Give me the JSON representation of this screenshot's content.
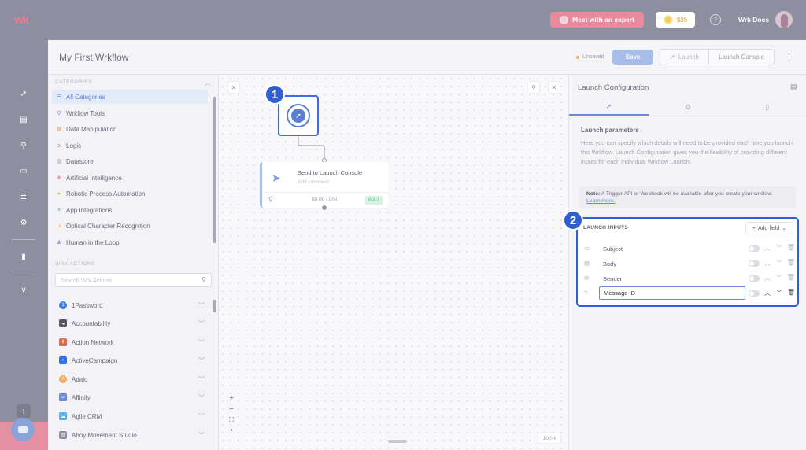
{
  "app": {
    "logo": "wk"
  },
  "topbar": {
    "meet_label": "Meet with an expert",
    "credits": "$35",
    "help_icon": "question-icon",
    "user_name": "Wrk Docs"
  },
  "rail": {
    "icons": [
      "rocket-icon",
      "id-card-icon",
      "wrench-icon",
      "folder-icon",
      "database-icon",
      "gear-icon",
      "book-icon",
      "cart-icon"
    ]
  },
  "header": {
    "title": "My First Wrkflow",
    "status": "Unsaved",
    "save_label": "Save",
    "launch_label": "Launch",
    "console_label": "Launch Console"
  },
  "categories": {
    "title": "CATEGORIES",
    "items": [
      {
        "label": "All Categories",
        "icon": "list-icon",
        "color": "#5b7fd1"
      },
      {
        "label": "Wrkflow Tools",
        "icon": "wrench-icon",
        "color": "#7a99de"
      },
      {
        "label": "Data Manipulation",
        "icon": "grid-icon",
        "color": "#e8a878"
      },
      {
        "label": "Logic",
        "icon": "greater-equal-icon",
        "color": "#e26a7a"
      },
      {
        "label": "Datastore",
        "icon": "database-icon",
        "color": "#8f8fa0"
      },
      {
        "label": "Artificial Intelligence",
        "icon": "brain-icon",
        "color": "#e88a9c"
      },
      {
        "label": "Robotic Process Automation",
        "icon": "robot-icon",
        "color": "#b7d35b"
      },
      {
        "label": "App Integrations",
        "icon": "plug-icon",
        "color": "#6cc7a0"
      },
      {
        "label": "Optical Character Recognition",
        "icon": "ocr-icon",
        "color": "#e8b24d"
      },
      {
        "label": "Human in the Loop",
        "icon": "person-icon",
        "color": "#b39ad8"
      }
    ]
  },
  "actions": {
    "title": "WRK ACTIONS",
    "search_placeholder": "Search Wrk Actions",
    "items": [
      {
        "label": "1Password",
        "color": "#3a7ee6"
      },
      {
        "label": "Accountability",
        "color": "#555566"
      },
      {
        "label": "Action Network",
        "color": "#e26a4a"
      },
      {
        "label": "ActiveCampaign",
        "color": "#3a6fe8"
      },
      {
        "label": "Adalo",
        "color": "#f0a860"
      },
      {
        "label": "Affinity",
        "color": "#6a8ad8"
      },
      {
        "label": "Agile CRM",
        "color": "#58b4e8"
      },
      {
        "label": "Ahoy Movement Studio",
        "color": "#8f8fa0"
      }
    ]
  },
  "canvas": {
    "step1": "1",
    "node_title": "Send to Launch Console",
    "node_sub": "Add comment",
    "node_cost": "$0.00 / unit",
    "node_badge": "WA-1",
    "zoom": "100%"
  },
  "config": {
    "title": "Launch Configuration",
    "tabs": [
      "rocket-icon",
      "gear-icon",
      "document-icon"
    ],
    "params_title": "Launch parameters",
    "params_desc": "Here you can specify which details will need to be provided each time you launch this Wrkflow. Launch Configuration gives you the flexibility of providing different inputs for each individual Wrkflow Launch.",
    "note_label": "Note:",
    "note_text": "A Trigger API or Webhook will be available after you create your wrkflow.",
    "note_link": "Learn more.",
    "step2": "2",
    "inputs_title": "LAUNCH INPUTS",
    "add_field": "Add field",
    "fields": [
      {
        "name": "Subject",
        "icon": "text-box-icon"
      },
      {
        "name": "Body",
        "icon": "document-icon"
      },
      {
        "name": "Sender",
        "icon": "email-icon"
      },
      {
        "name": "Message ID",
        "icon": "text-icon",
        "editing": true
      }
    ]
  }
}
